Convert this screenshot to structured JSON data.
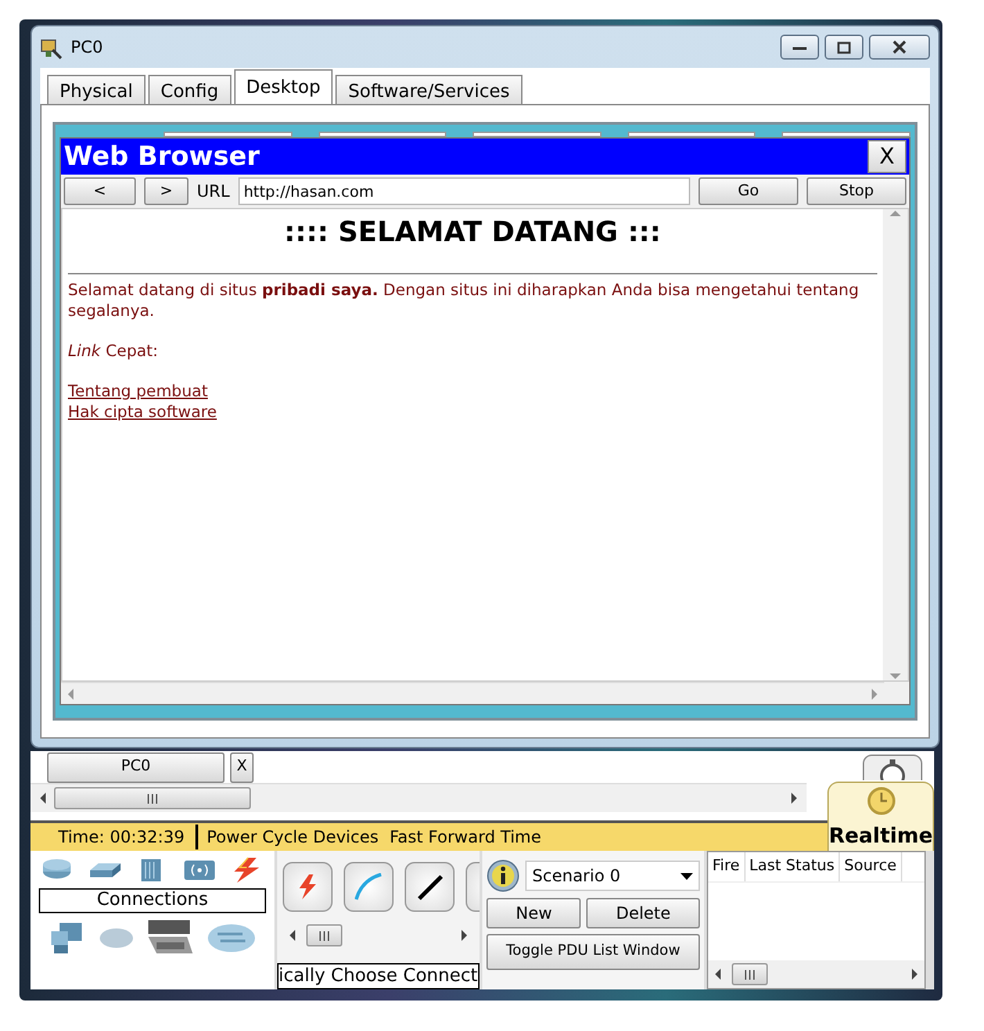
{
  "window": {
    "title": "PC0"
  },
  "tabs": [
    {
      "label": "Physical",
      "selected": false
    },
    {
      "label": "Config",
      "selected": false
    },
    {
      "label": "Desktop",
      "selected": true
    },
    {
      "label": "Software/Services",
      "selected": false
    }
  ],
  "browser": {
    "title": "Web Browser",
    "close": "X",
    "back": "<",
    "forward": ">",
    "url_label": "URL",
    "url": "http://hasan.com",
    "go": "Go",
    "stop": "Stop",
    "page": {
      "heading": ":::: SELAMAT DATANG :::",
      "paragraph": "Selamat datang di situs **pribadi saya.** Dengan situs ini diharapkan Anda bisa mengetahui tentang segalanya.",
      "quick_links": "*Link* Cepat:",
      "links": [
        "Tentang pembuat",
        "Hak cipta software"
      ]
    }
  },
  "workspace": {
    "open_window": "PC0",
    "close": "X"
  },
  "status_bar": {
    "time": "Time: 00:32:39",
    "buttons": [
      "Power Cycle Devices",
      "Fast Forward Time"
    ],
    "mode": "Realtime"
  },
  "device_panel": {
    "category": "Connections",
    "caption": "ically Choose Connect"
  },
  "scenario": {
    "name": "Scenario 0",
    "buttons": [
      "New",
      "Delete"
    ],
    "toggle": "Toggle PDU List Window"
  },
  "pdu_table": {
    "columns": [
      "Fire",
      "Last Status",
      "Source"
    ]
  }
}
